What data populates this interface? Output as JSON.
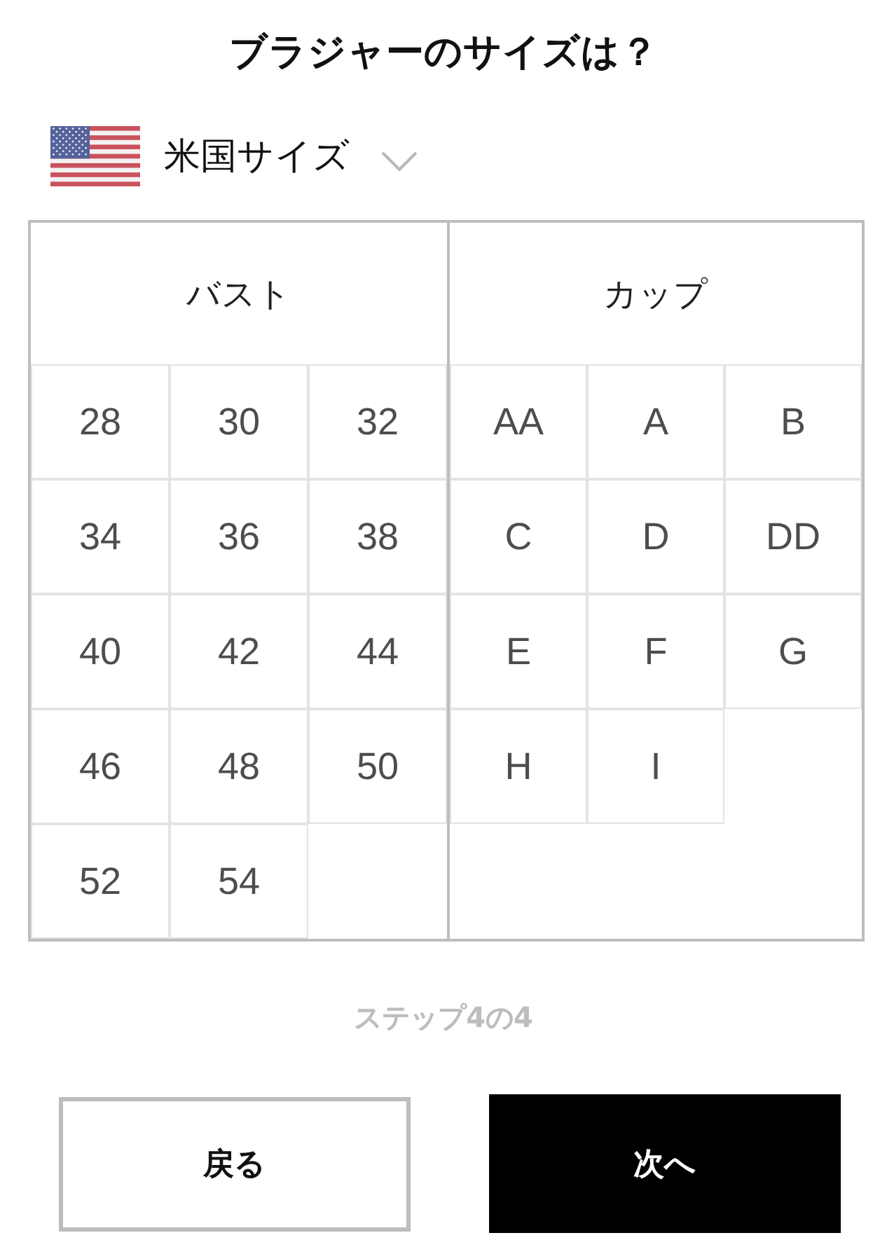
{
  "title": "ブラジャーのサイズは？",
  "size_system": {
    "label": "米国サイズ"
  },
  "size_table": {
    "columns": [
      {
        "heading": "バスト",
        "options": [
          {
            "label": "28",
            "selected": false
          },
          {
            "label": "30",
            "selected": false
          },
          {
            "label": "32",
            "selected": false
          },
          {
            "label": "34",
            "selected": false
          },
          {
            "label": "36",
            "selected": false
          },
          {
            "label": "38",
            "selected": false
          },
          {
            "label": "40",
            "selected": false
          },
          {
            "label": "42",
            "selected": false
          },
          {
            "label": "44",
            "selected": false
          },
          {
            "label": "46",
            "selected": false
          },
          {
            "label": "48",
            "selected": false
          },
          {
            "label": "50",
            "selected": false
          },
          {
            "label": "52",
            "selected": false
          },
          {
            "label": "54",
            "selected": false
          }
        ]
      },
      {
        "heading": "カップ",
        "options": [
          {
            "label": "AA",
            "selected": false
          },
          {
            "label": "A",
            "selected": false
          },
          {
            "label": "B",
            "selected": false
          },
          {
            "label": "C",
            "selected": false
          },
          {
            "label": "D",
            "selected": false
          },
          {
            "label": "DD",
            "selected": false
          },
          {
            "label": "E",
            "selected": false
          },
          {
            "label": "F",
            "selected": false
          },
          {
            "label": "G",
            "selected": false
          },
          {
            "label": "H",
            "selected": false
          },
          {
            "label": "I",
            "selected": false
          }
        ]
      }
    ]
  },
  "step_indicator": "ステップ4の4",
  "buttons": [
    {
      "label": "戻る",
      "kind": "secondary"
    },
    {
      "label": "次へ",
      "kind": "primary"
    }
  ]
}
